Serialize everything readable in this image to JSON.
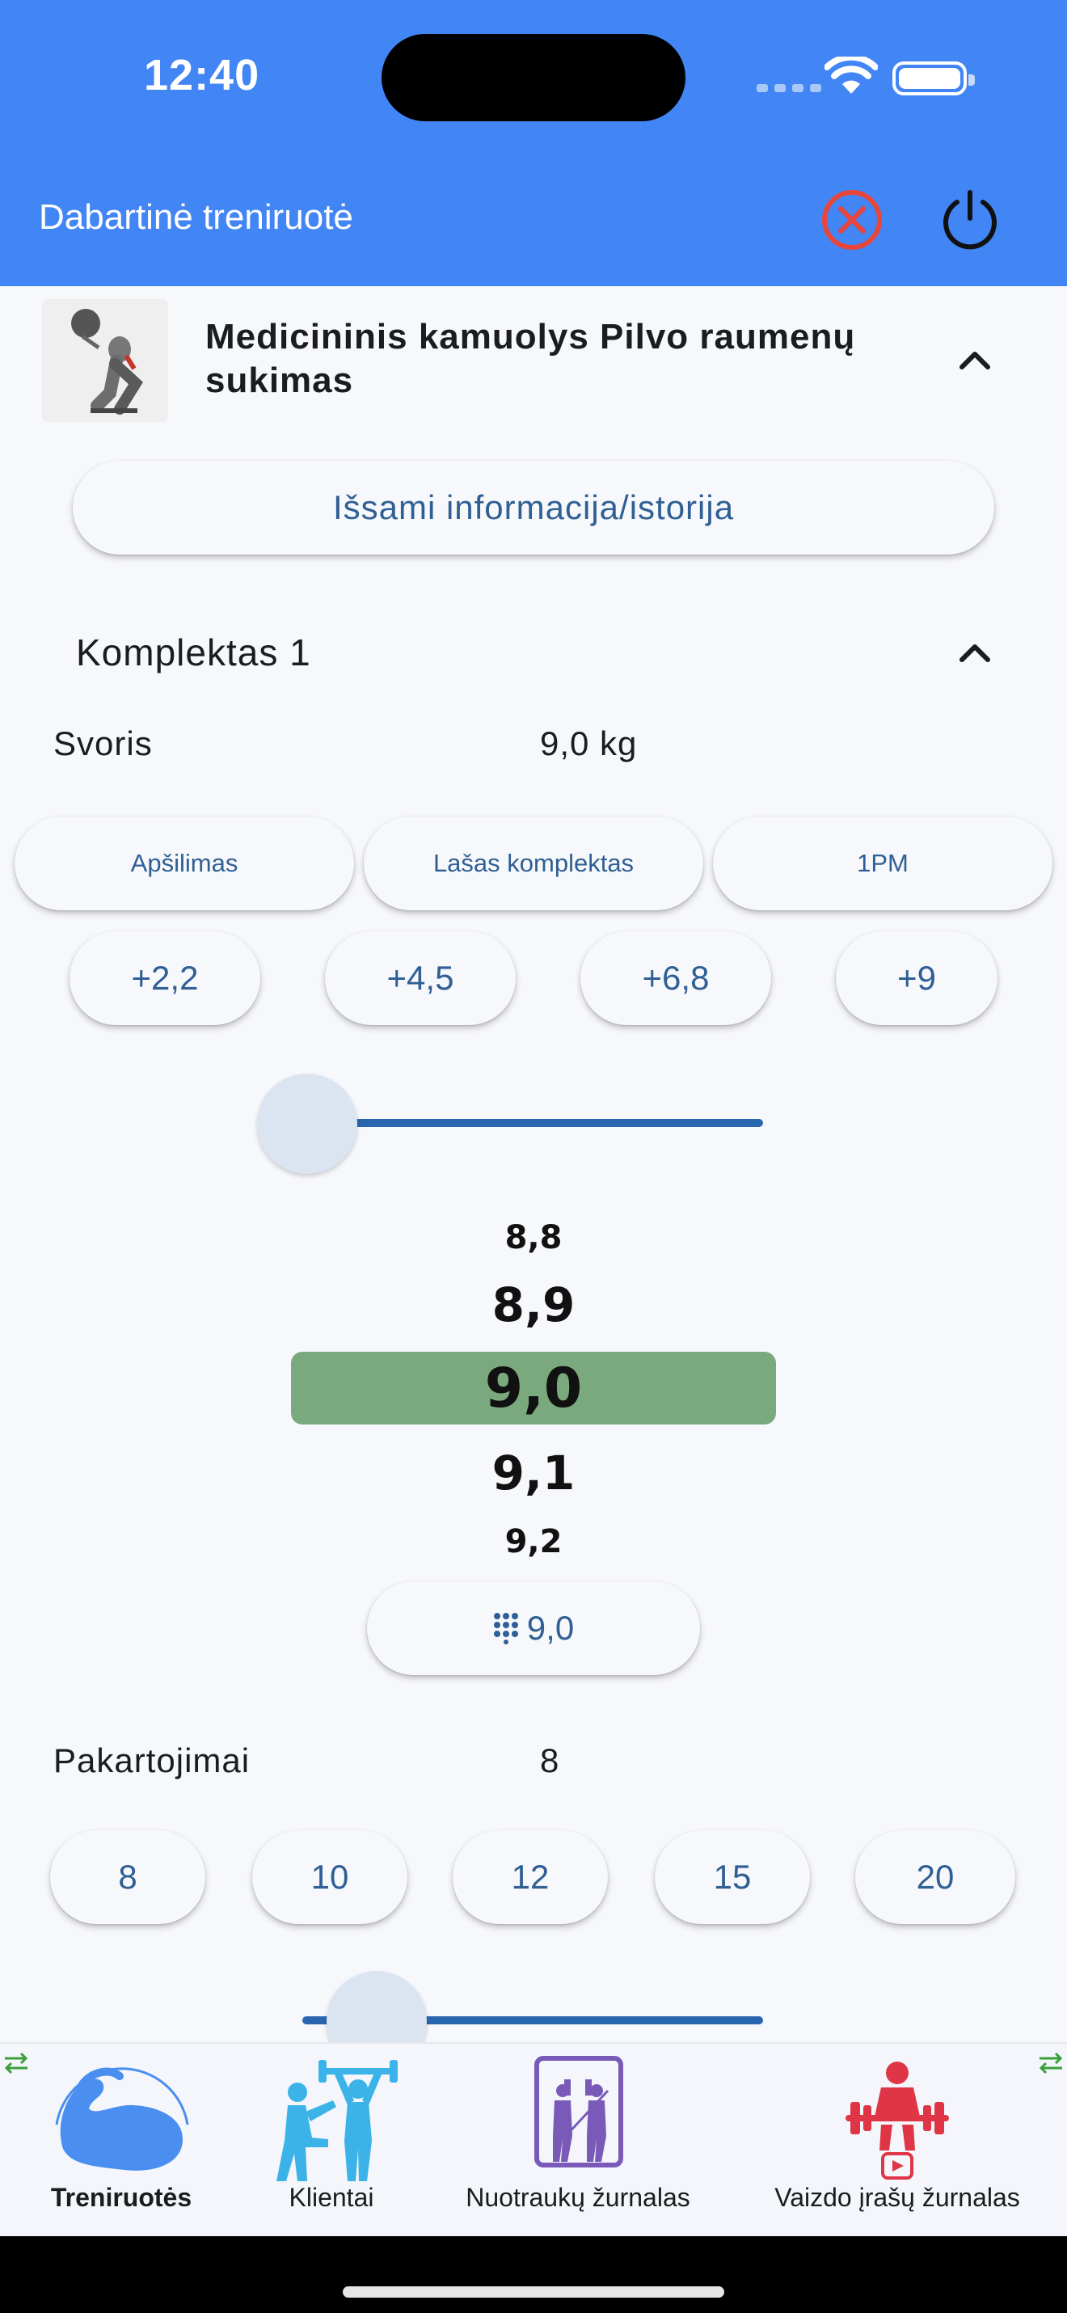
{
  "status_bar": {
    "time": "12:40"
  },
  "app_bar": {
    "title": "Dabartinė treniruotė",
    "close_icon": "close-circle-icon",
    "power_icon": "power-icon"
  },
  "exercise": {
    "title": "Medicininis kamuolys Pilvo raumenų sukimas",
    "details_button": "Išsami informacija/istorija"
  },
  "set": {
    "title": "Komplektas 1",
    "weight_label": "Svoris",
    "weight_value": "9,0 kg",
    "type_buttons": [
      "Apšilimas",
      "Lašas komplektas",
      "1PM"
    ],
    "increment_buttons": [
      "+2,2",
      "+4,5",
      "+6,8",
      "+9"
    ],
    "picker_values": [
      "8,8",
      "8,9",
      "9,0",
      "9,1",
      "9,2"
    ],
    "keypad_button": "9,0",
    "reps_label": "Pakartojimai",
    "reps_value": "8",
    "reps_buttons": [
      "8",
      "10",
      "12",
      "15",
      "20"
    ]
  },
  "bottom_nav": {
    "items": [
      {
        "label": "Treniruotės",
        "icon": "bicep-icon",
        "active": true
      },
      {
        "label": "Klientai",
        "icon": "trainer-client-icon",
        "active": false
      },
      {
        "label": "Nuotraukų žurnalas",
        "icon": "mirror-photo-icon",
        "active": false
      },
      {
        "label": "Vaizdo įrašų žurnalas",
        "icon": "weightlifter-video-icon",
        "active": false
      }
    ]
  },
  "colors": {
    "app_bar": "#4285f4",
    "accent_text": "#2f5f94",
    "slider": "#2a66b0",
    "picker_selection": "#7aa97d",
    "close_icon": "#e8453c"
  }
}
